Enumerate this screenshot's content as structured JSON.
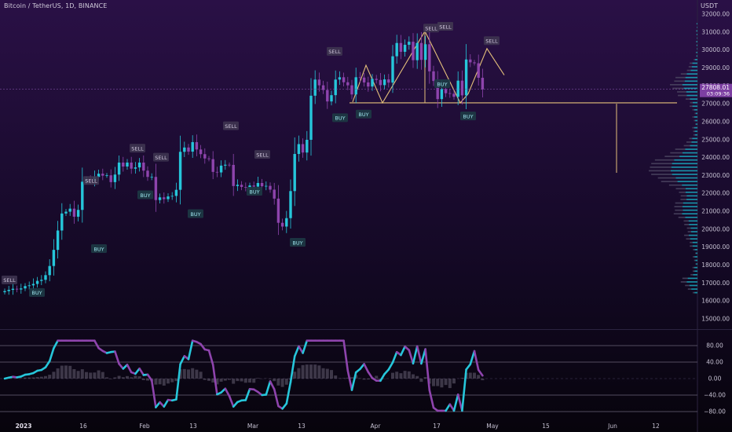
{
  "header": {
    "title": "Bitcoin / TetherUS, 1D, BINANCE",
    "unit": "USDT"
  },
  "price_axis": {
    "labels": [
      "32000.00",
      "31000.00",
      "30000.00",
      "29000.00",
      "28000.00",
      "27000.00",
      "26000.00",
      "25000.00",
      "24000.00",
      "23000.00",
      "22000.00",
      "21000.00",
      "20000.00",
      "19000.00",
      "18000.00",
      "17000.00",
      "16000.00",
      "15000.00"
    ],
    "current_price": "27808.01",
    "countdown": "03:09:36"
  },
  "osc_axis": {
    "labels": [
      "80.00",
      "40.00",
      "0.00",
      "−40.00",
      "−80.00"
    ]
  },
  "time_axis": {
    "labels": [
      "2023",
      "16",
      "Feb",
      "13",
      "Mar",
      "13",
      "Apr",
      "17",
      "May",
      "15",
      "Jun",
      "12"
    ]
  },
  "signals": [
    {
      "text": "SELL",
      "type": "sell"
    },
    {
      "text": "BUY",
      "type": "buy"
    },
    {
      "text": "BUY",
      "type": "buy"
    },
    {
      "text": "SELL",
      "type": "sell"
    },
    {
      "text": "SELL",
      "type": "sell"
    },
    {
      "text": "BUY",
      "type": "buy"
    },
    {
      "text": "SELL",
      "type": "sell"
    },
    {
      "text": "BUY",
      "type": "buy"
    },
    {
      "text": "SELL",
      "type": "sell"
    },
    {
      "text": "SELL",
      "type": "sell"
    },
    {
      "text": "BUY",
      "type": "buy"
    },
    {
      "text": "BUY",
      "type": "buy"
    },
    {
      "text": "SELL",
      "type": "sell"
    },
    {
      "text": "BUY",
      "type": "buy"
    },
    {
      "text": "BUY",
      "type": "buy"
    },
    {
      "text": "SELL",
      "type": "sell"
    },
    {
      "text": "BUY",
      "type": "buy"
    },
    {
      "text": "SELL",
      "type": "sell"
    },
    {
      "text": "BUY",
      "type": "buy"
    },
    {
      "text": "SELL",
      "type": "sell"
    },
    {
      "text": "SELL",
      "type": "sell"
    }
  ],
  "chart_data": {
    "type": "candlestick",
    "symbol": "BTCUSDT",
    "interval": "1D",
    "ylim": [
      15000,
      32000
    ],
    "osc_ylim": [
      -100,
      100
    ],
    "osc_levels": [
      80,
      40,
      0,
      -40,
      -80
    ],
    "close_start_day": 0,
    "closes": [
      16550,
      16620,
      16680,
      16640,
      16700,
      16830,
      16870,
      16950,
      17120,
      17180,
      17440,
      17950,
      18850,
      19930,
      20880,
      20980,
      21150,
      20700,
      21080,
      22650,
      22780,
      22710,
      22920,
      23100,
      22990,
      23010,
      22630,
      23050,
      23720,
      23500,
      23720,
      23380,
      23450,
      23720,
      23270,
      22920,
      22920,
      21630,
      21780,
      21680,
      21830,
      21860,
      22200,
      24320,
      24560,
      24330,
      24860,
      24450,
      24190,
      23950,
      23910,
      23200,
      23170,
      23550,
      23600,
      23590,
      22410,
      22480,
      22360,
      22340,
      22440,
      22380,
      22580,
      22400,
      22420,
      22210,
      21710,
      20360,
      20150,
      20620,
      22130,
      24200,
      24750,
      24280,
      24990,
      27450,
      28350,
      28030,
      27770,
      27130,
      27480,
      28350,
      28480,
      28200,
      28030,
      27520,
      28480,
      28460,
      28190,
      27960,
      28390,
      28330,
      28040,
      28360,
      28180,
      29650,
      30390,
      29900,
      30290,
      30460,
      29430,
      30390,
      29450,
      30320,
      28810,
      28270,
      27260,
      27820,
      27590,
      27560,
      27390,
      28290,
      27470,
      29470,
      29310,
      29260,
      28450,
      27808
    ],
    "colors": {
      "up": "#26c6da",
      "down": "#8e44ad",
      "neckline": "#e5c07b",
      "volume_up": "#1aa9bd",
      "volume_down": "#4b4560"
    }
  }
}
